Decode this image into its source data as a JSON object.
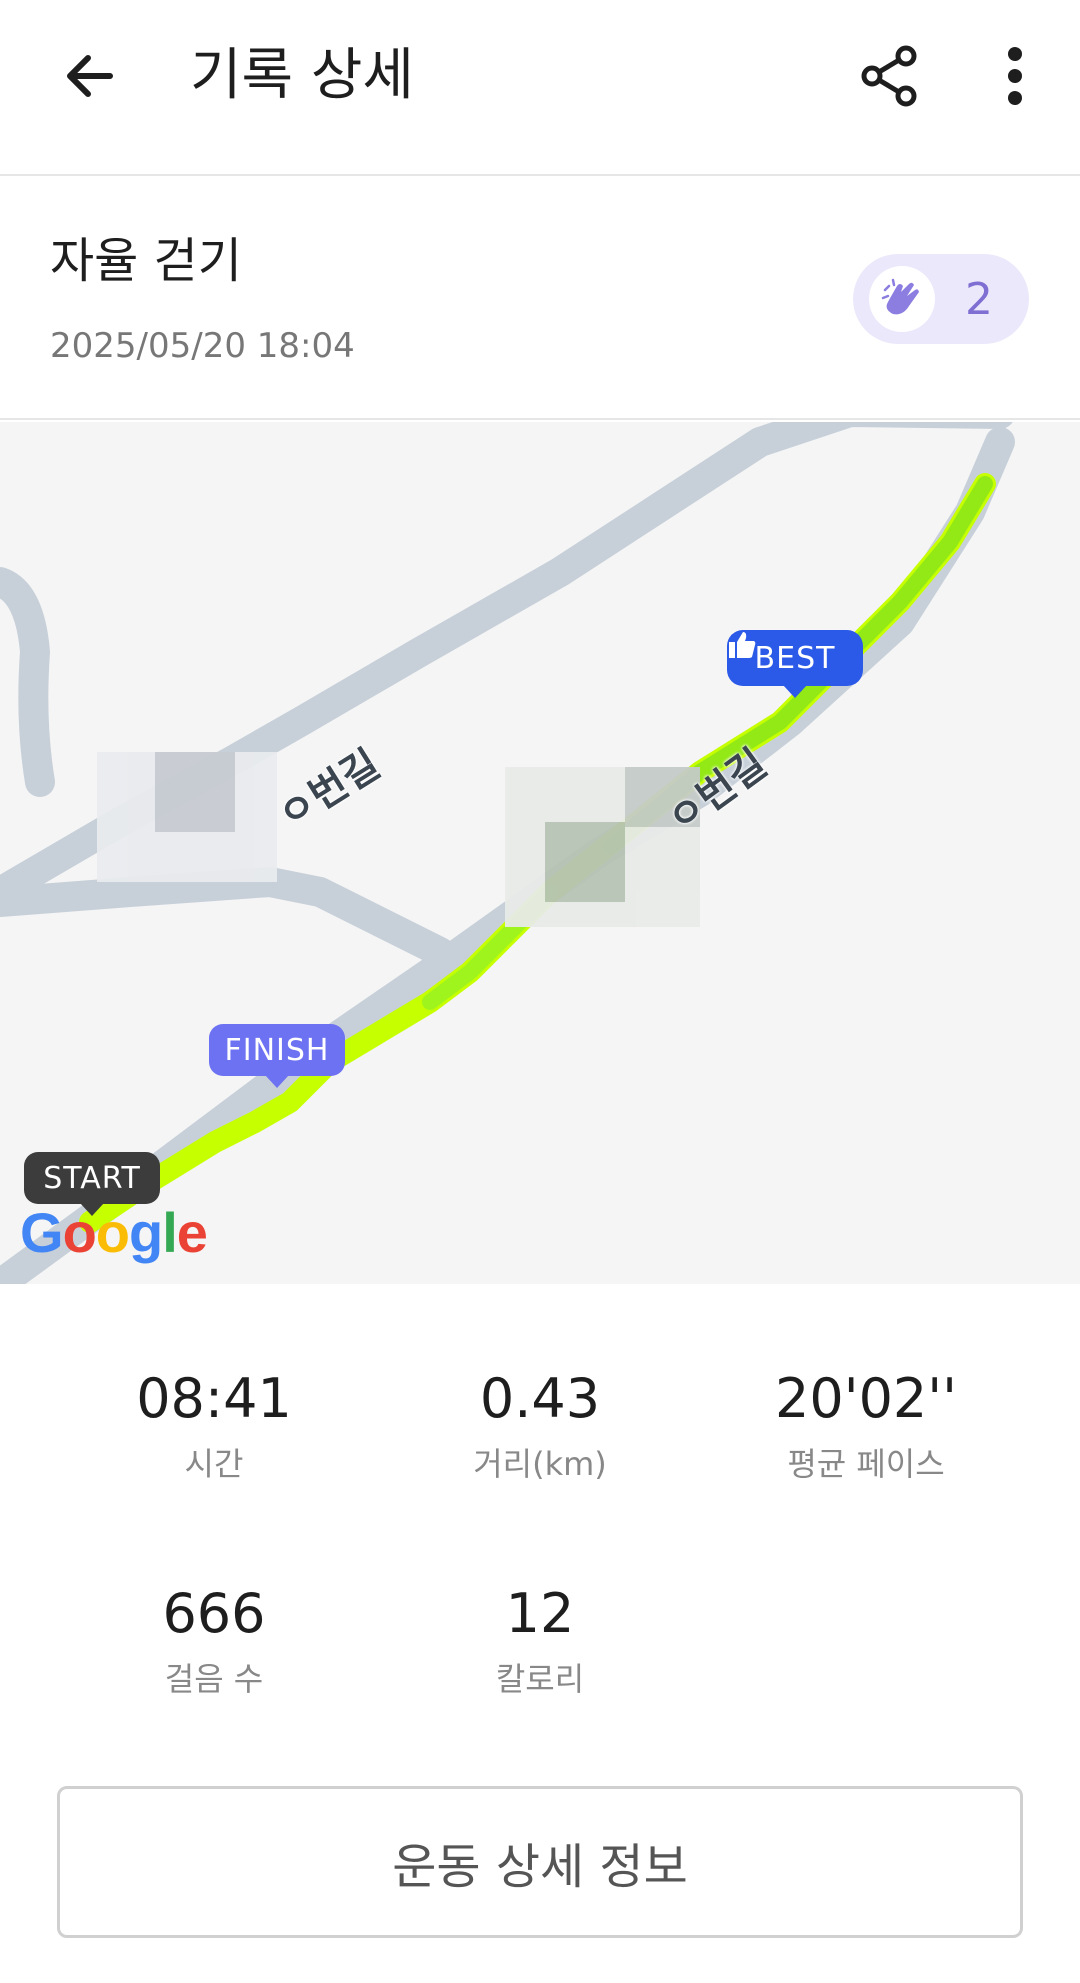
{
  "header": {
    "title": "기록 상세",
    "icons": [
      "back-arrow-icon",
      "share-icon",
      "more-vertical-icon"
    ]
  },
  "summary": {
    "activity_name": "자율 걷기",
    "date_time": "2025/05/20 18:04",
    "clap_count": "2",
    "clap_color": "#7f6fd3"
  },
  "map": {
    "markers": {
      "best": "BEST",
      "finish": "FINISH",
      "start": "START"
    },
    "road_labels": [
      "ㅇ번길",
      "ㅇ번길"
    ],
    "attribution": "Google",
    "route_color": "#c6ff00",
    "road_color": "#c7d0d9"
  },
  "stats": [
    {
      "value": "08:41",
      "label": "시간"
    },
    {
      "value": "0.43",
      "label": "거리(km)"
    },
    {
      "value": "20'02''",
      "label": "평균 페이스"
    },
    {
      "value": "666",
      "label": "걸음 수"
    },
    {
      "value": "12",
      "label": "칼로리"
    }
  ],
  "detail_button": "운동 상세 정보"
}
